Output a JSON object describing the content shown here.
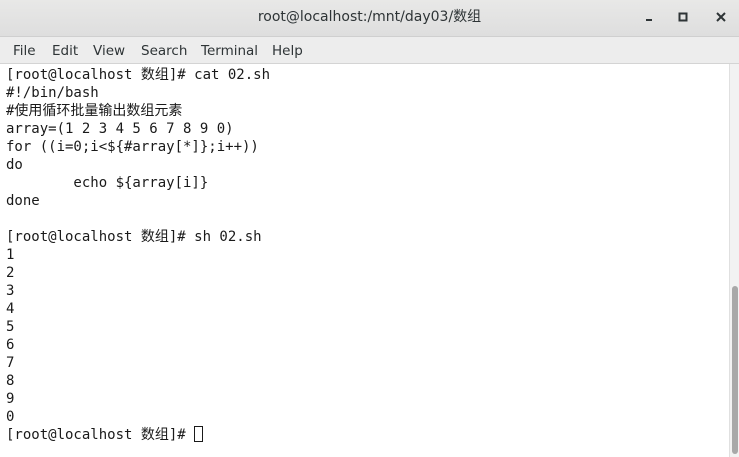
{
  "window": {
    "title": "root@localhost:/mnt/day03/数组",
    "minimize_icon": "minimize-icon",
    "maximize_icon": "maximize-icon",
    "close_icon": "close-icon"
  },
  "menu": {
    "file": "File",
    "edit": "Edit",
    "view": "View",
    "search": "Search",
    "terminal": "Terminal",
    "help": "Help"
  },
  "terminal": {
    "lines": [
      "[root@localhost 数组]# cat 02.sh",
      "#!/bin/bash",
      "#使用循环批量输出数组元素",
      "array=(1 2 3 4 5 6 7 8 9 0)",
      "for ((i=0;i<${#array[*]};i++))",
      "do",
      "        echo ${array[i]}",
      "done",
      "",
      "[root@localhost 数组]# sh 02.sh",
      "1",
      "2",
      "3",
      "4",
      "5",
      "6",
      "7",
      "8",
      "9",
      "0"
    ],
    "prompt": "[root@localhost 数组]# "
  }
}
